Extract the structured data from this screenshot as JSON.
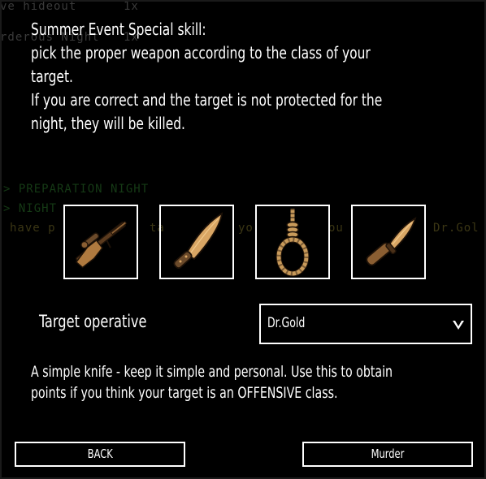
{
  "background": {
    "line1": "ve hideout",
    "line1_count": "1x",
    "line2": "rderous Night",
    "line2_count": "1x",
    "log1": "> PREPARATION NIGHT",
    "log2": "> NIGHT",
    "log3": "have p",
    "log4": "ta",
    "log5": "yo",
    "log6": "ou",
    "log7": "Dr.Gol"
  },
  "dialog": {
    "description": "Summer Event Special skill:\npick the proper weapon according to the class of your target.\nIf you are correct and the target is not protected for the night, they will be killed.",
    "weapons": [
      {
        "name": "sniper-rifle",
        "icon": "rifle-icon"
      },
      {
        "name": "machete",
        "icon": "machete-icon"
      },
      {
        "name": "noose",
        "icon": "noose-icon"
      },
      {
        "name": "knife",
        "icon": "knife-icon"
      }
    ],
    "target_label": "Target operative",
    "target_value": "Dr.Gold",
    "weapon_description": "A simple knife - keep it simple and personal. Use this to obtain points if you think your target is an OFFENSIVE class.",
    "back_label": "BACK",
    "murder_label": "Murder"
  },
  "colors": {
    "wood": "#b07a3f",
    "metal": "#6b4a2a",
    "rope": "#c89a5a"
  }
}
